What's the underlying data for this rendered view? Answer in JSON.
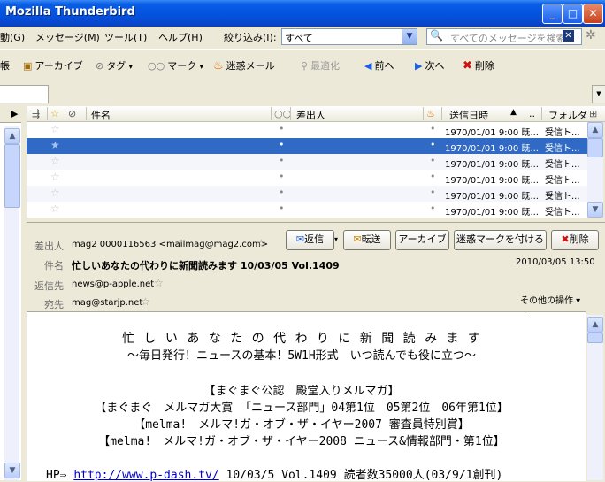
{
  "window": {
    "title": "Mozilla Thunderbird"
  },
  "menubar": {
    "items": [
      "動(G)",
      "メッセージ(M)",
      "ツール(T)",
      "ヘルプ(H)"
    ],
    "filter_label": "絞り込み(I):",
    "filter_value": "すべて",
    "search_placeholder": "すべてのメッセージを検索"
  },
  "toolbar": {
    "partial_label": "帳",
    "archive": "アーカイブ",
    "tag": "タグ",
    "mark": "マーク",
    "junk": "迷惑メール",
    "optimize": "最適化",
    "prev": "前へ",
    "next": "次へ",
    "delete": "削除"
  },
  "columns": {
    "subject": "件名",
    "sender": "差出人",
    "date": "送信日時",
    "folder": "フォルダ"
  },
  "messages": [
    {
      "date": "1970/01/01 9:00 既...",
      "folder": "受信ト..."
    },
    {
      "date": "1970/01/01 9:00 既...",
      "folder": "受信ト..."
    },
    {
      "date": "1970/01/01 9:00 既...",
      "folder": "受信ト..."
    },
    {
      "date": "1970/01/01 9:00 既...",
      "folder": "受信ト..."
    },
    {
      "date": "1970/01/01 9:00 既...",
      "folder": "受信ト..."
    },
    {
      "date": "1970/01/01 9:00 既...",
      "folder": "受信ト..."
    }
  ],
  "header": {
    "from_label": "差出人",
    "from_value": "mag2 0000116563 <mailmag@mag2.com>",
    "subject_label": "件名",
    "subject_value": "忙しいあなたの代わりに新聞読みます 10/03/05 Vol.1409",
    "replyto_label": "返信先",
    "replyto_value": "news@p-apple.net",
    "to_label": "宛先",
    "to_value": "mag@starjp.net",
    "date_value": "2010/03/05 13:50",
    "other_actions": "その他の操作 ▾",
    "reply": "返信",
    "forward": "転送",
    "archive": "アーカイブ",
    "mark_junk": "迷惑マークを付ける",
    "delete": "削除"
  },
  "body": {
    "line1": "忙 し い あ な た の 代 わ り に 新 聞 読 み ま す",
    "line2": "～毎日発行！ニュースの基本！5W1H形式　いつ読んでも役に立つ～",
    "line3": "【まぐまぐ公認　殿堂入りメルマガ】",
    "line4": "【まぐまぐ　メルマガ大賞 「ニュース部門」04第1位　05第2位　06年第1位】",
    "line5": "【melma!　メルマ!ガ・オブ・ザ・イヤー2007 審査員特別賞】",
    "line6": "【melma!　メルマ!ガ・オブ・ザ・イヤー2008 ニュース&情報部門・第1位】",
    "hp_prefix": "HP⇒ ",
    "hp_link": "http://www.p-dash.tv/",
    "hp_suffix": " 10/03/5 Vol.1409 読者数35000人(03/9/1創刊)"
  }
}
